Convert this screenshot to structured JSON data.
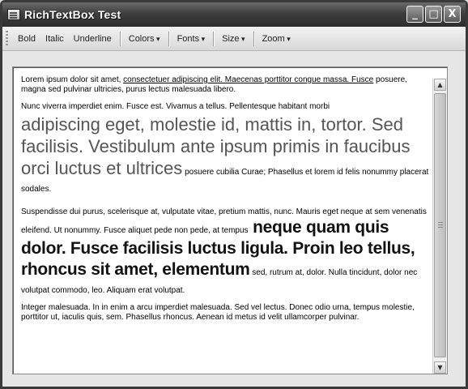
{
  "window": {
    "title": "RichTextBox Test",
    "caption_buttons": {
      "minimize": "_",
      "maximize": "□",
      "close": "X"
    }
  },
  "toolbar": {
    "items": [
      "Bold",
      "Italic",
      "Underline",
      "Colors",
      "Fonts",
      "Size",
      "Zoom"
    ]
  },
  "content": {
    "p1": {
      "plain": "Lorem ipsum dolor sit amet, ",
      "underlined": "consectetuer adipiscing elit. Maecenas porttitor congue massa. Fusce",
      "rest": " posuere, magna sed pulvinar ultricies, purus lectus malesuada libero."
    },
    "p2": {
      "small_intro": "Nunc viverra imperdiet enim. Fusce est. Vivamus a tellus. Pellentesque habitant morbi",
      "large": "adipiscing eget, molestie id, mattis in, tortor. Sed facilisis. Vestibulum ante ipsum primis in faucibus orci luctus et ultrices",
      "small_tail": " posuere cubilia Curae; Phasellus et lorem id felis nonummy placerat sodales."
    },
    "p3": {
      "small_intro": "Suspendisse dui purus, scelerisque at, vulputate vitae, pretium mattis, nunc. Mauris eget neque at sem venenatis eleifend. Ut nonummy. Fusce aliquet pede non pede, at tempus",
      "bold_large": " neque quam quis dolor. Fusce facilisis luctus ligula. Proin leo tellus, rhoncus sit amet, elementum",
      "small_tail": " sed, rutrum at, dolor. Nulla tincidunt, dolor nec volutpat commodo, leo. Aliquam erat volutpat."
    },
    "p4": {
      "small": "Integer malesuada. In in enim a arcu imperdiet malesuada. Sed vel lectus. Donec odio urna, tempus molestie, porttitor ut, iaculis quis, sem. Phasellus rhoncus. Aenean id metus id velit ullamcorper pulvinar."
    }
  },
  "scrollbar": {
    "up_arrow": "▲",
    "down_arrow": "▼"
  }
}
